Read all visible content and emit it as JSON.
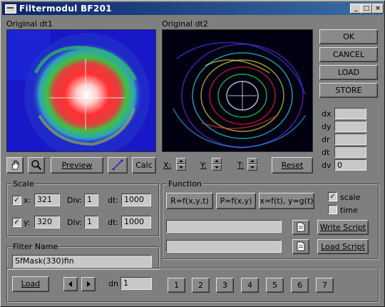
{
  "window": {
    "title": "Filtermodul  BF201",
    "minimize": "_",
    "maximize": "□",
    "close": "×"
  },
  "images": {
    "left_label": "Original dt1",
    "right_label": "Original dt2"
  },
  "right_buttons": {
    "ok": "OK",
    "cancel": "CANCEL",
    "load": "LOAD",
    "store": "STORE"
  },
  "params": [
    {
      "label": "dx",
      "value": ""
    },
    {
      "label": "dy",
      "value": ""
    },
    {
      "label": "dr",
      "value": ""
    },
    {
      "label": "dt",
      "value": ""
    },
    {
      "label": "dv",
      "value": "0"
    }
  ],
  "toolbar": {
    "preview": "Preview",
    "calc": "Calc",
    "x_label": "X:",
    "y_label": "Y:",
    "t_label": "T:",
    "reset": "Reset"
  },
  "scale": {
    "title": "Scale",
    "x": {
      "label": "x:",
      "value": "321",
      "div_label": "Div:",
      "div": "1",
      "dt_label": "dt:",
      "dt": "1000"
    },
    "y": {
      "label": "y:",
      "value": "320",
      "div_label": "Div:",
      "div": "1",
      "dt_label": "dt:",
      "dt": "1000"
    }
  },
  "function": {
    "title": "Function",
    "b1": "R=f(x,y,t)",
    "b2": "P=f(x,y)",
    "b3": "x=f(t), y=g(t)",
    "scale_label": "scale",
    "time_label": "time",
    "write_script": "Write Script",
    "load_script": "Load Script"
  },
  "filter": {
    "title": "Filter Name",
    "value": "SfMask(330)fin"
  },
  "bottom": {
    "load": "Load",
    "dn_label": "dn",
    "dn_value": "1",
    "numbers": [
      "1",
      "2",
      "3",
      "4",
      "5",
      "6",
      "7"
    ]
  },
  "colors": {
    "title_start": "#0a246a",
    "title_end": "#3a6ea5",
    "face": "#7f7f7f"
  }
}
